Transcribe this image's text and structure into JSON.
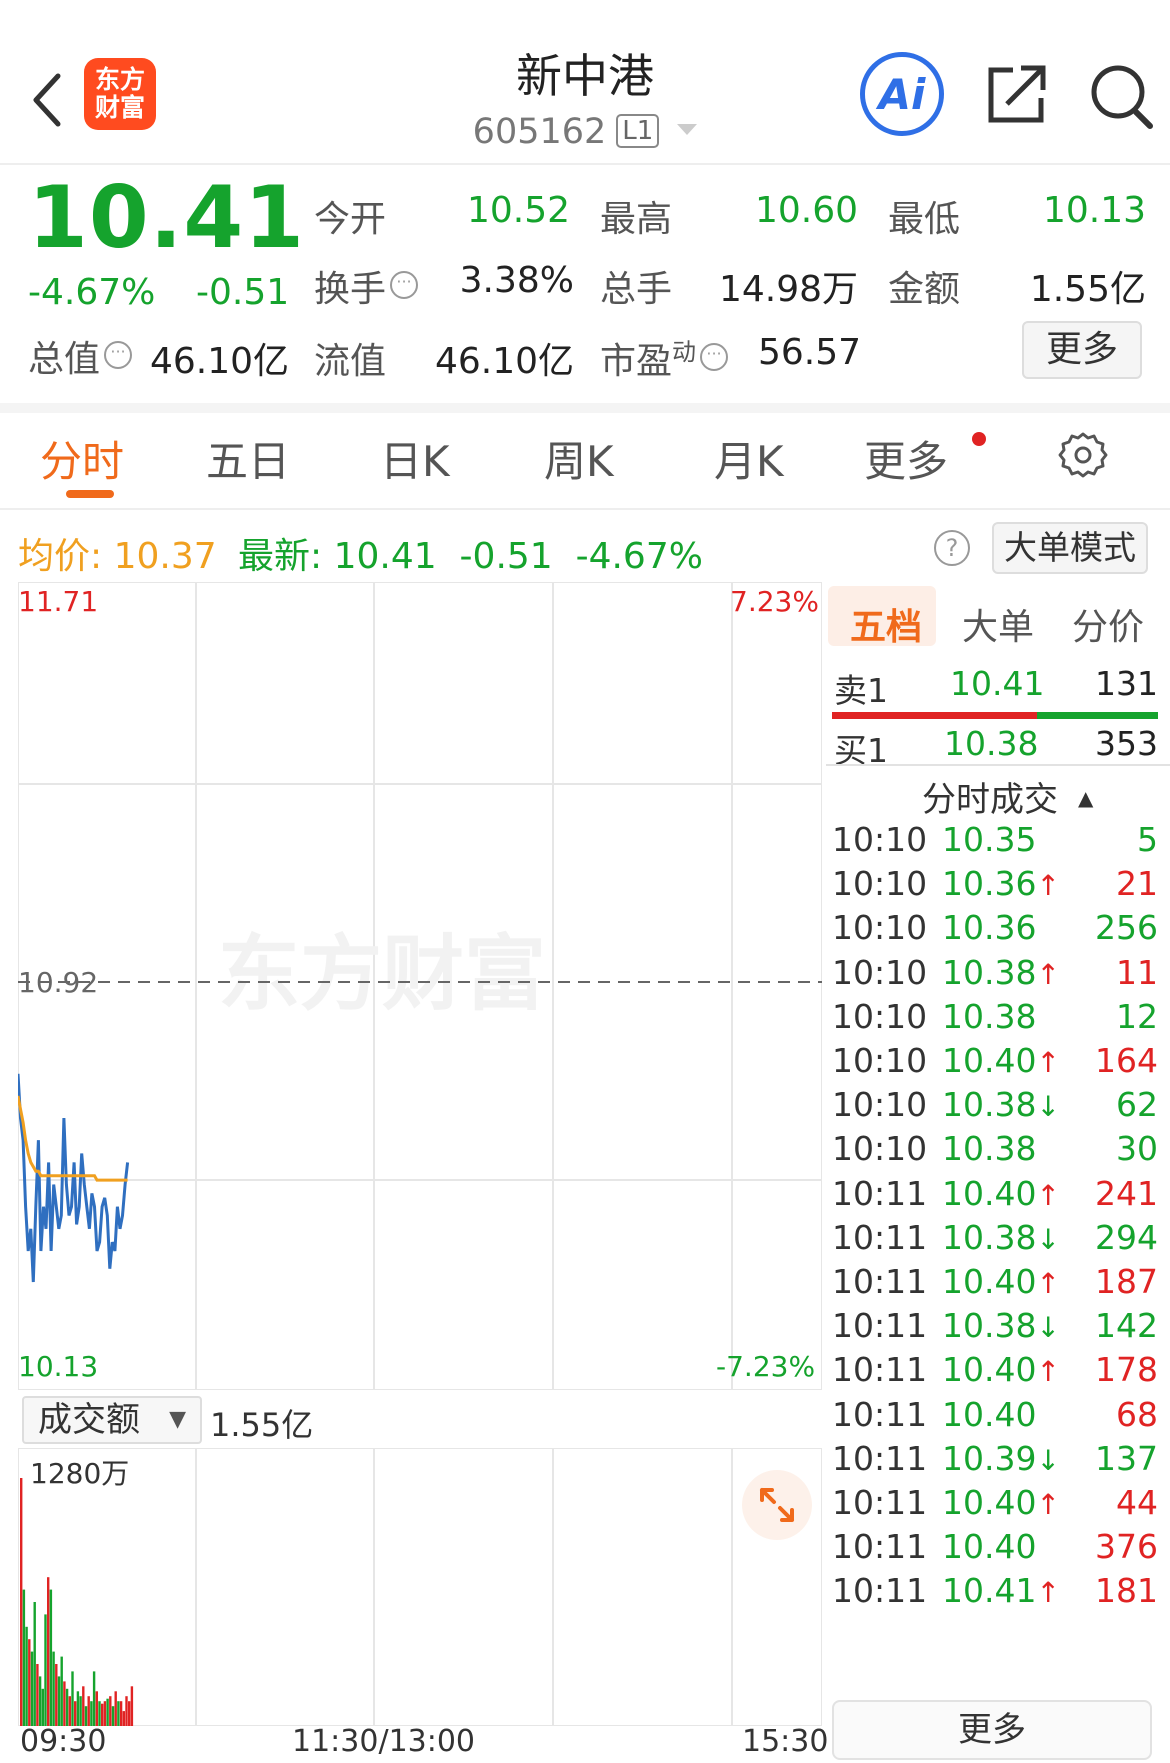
{
  "header": {
    "logo_text_line1": "东方",
    "logo_text_line2": "财富",
    "stock_name": "新中港",
    "stock_code": "605162",
    "level_badge": "L1",
    "ai_label": "Ai"
  },
  "quote": {
    "last_price": "10.41",
    "change_pct": "-4.67%",
    "change_abs": "-0.51",
    "open_label": "今开",
    "open": "10.52",
    "high_label": "最高",
    "high": "10.60",
    "low_label": "最低",
    "low": "10.13",
    "turnover_label": "换手",
    "turnover": "3.38%",
    "volume_label": "总手",
    "volume": "14.98万",
    "amount_label": "金额",
    "amount": "1.55亿",
    "mktcap_label": "总值",
    "mktcap": "46.10亿",
    "float_label": "流值",
    "float_cap": "46.10亿",
    "pe_label": "市盈",
    "pe_sup": "动",
    "pe": "56.57",
    "more_button": "更多"
  },
  "tabs": [
    "分时",
    "五日",
    "日K",
    "周K",
    "月K",
    "更多"
  ],
  "info_bar": {
    "avg_label": "均价:",
    "avg": "10.37",
    "latest_label": "最新:",
    "latest": "10.41",
    "latest_chg": "-0.51",
    "latest_pct": "-4.67%",
    "help_icon": "?",
    "big_order_mode": "大单模式"
  },
  "chart_data": {
    "type": "line",
    "y_max_label": "11.71",
    "y_min_label": "10.13",
    "pct_max_label": "7.23%",
    "pct_min_label": "-7.23%",
    "ref_label": "10.92",
    "ylim": [
      10.13,
      11.71
    ],
    "reference_close": 10.92,
    "series": [
      {
        "values": [
          10.6,
          10.5,
          10.45,
          10.3,
          10.2,
          10.25,
          10.13,
          10.3,
          10.45,
          10.2,
          10.3,
          10.25,
          10.4,
          10.2,
          10.35,
          10.3,
          10.25,
          10.28,
          10.5,
          10.35,
          10.28,
          10.3,
          10.4,
          10.26,
          10.3,
          10.42,
          10.35,
          10.3,
          10.25,
          10.33,
          10.3,
          10.2,
          10.22,
          10.3,
          10.32,
          10.28,
          10.16,
          10.22,
          10.2,
          10.3,
          10.25,
          10.28,
          10.35,
          10.4
        ]
      },
      {
        "values": [
          10.55,
          10.52,
          10.49,
          10.45,
          10.42,
          10.4,
          10.39,
          10.38,
          10.38,
          10.37,
          10.37,
          10.37,
          10.37,
          10.37,
          10.37,
          10.37,
          10.37,
          10.37,
          10.37,
          10.37,
          10.37,
          10.37,
          10.37,
          10.37,
          10.37,
          10.37,
          10.37,
          10.37,
          10.37,
          10.37,
          10.37,
          10.36,
          10.36,
          10.36,
          10.36,
          10.36,
          10.36,
          10.36,
          10.36,
          10.36,
          10.36,
          10.36,
          10.36,
          10.36
        ]
      }
    ],
    "colors": {
      "price": "#2f6fc0",
      "avg": "#f0a020",
      "up": "#e02323",
      "down": "#15a32d"
    }
  },
  "volume": {
    "selector": "成交额",
    "total": "1.55亿",
    "max_label": "1280万",
    "bars": [
      {
        "v": 1.0,
        "c": "r"
      },
      {
        "v": 0.55,
        "c": "g"
      },
      {
        "v": 0.4,
        "c": "g"
      },
      {
        "v": 0.35,
        "c": "r"
      },
      {
        "v": 0.3,
        "c": "g"
      },
      {
        "v": 0.5,
        "c": "g"
      },
      {
        "v": 0.25,
        "c": "r"
      },
      {
        "v": 0.2,
        "c": "g"
      },
      {
        "v": 0.15,
        "c": "g"
      },
      {
        "v": 0.45,
        "c": "g"
      },
      {
        "v": 0.6,
        "c": "r"
      },
      {
        "v": 0.55,
        "c": "g"
      },
      {
        "v": 0.3,
        "c": "g"
      },
      {
        "v": 0.25,
        "c": "r"
      },
      {
        "v": 0.2,
        "c": "g"
      },
      {
        "v": 0.28,
        "c": "g"
      },
      {
        "v": 0.18,
        "c": "r"
      },
      {
        "v": 0.15,
        "c": "g"
      },
      {
        "v": 0.12,
        "c": "r"
      },
      {
        "v": 0.22,
        "c": "g"
      },
      {
        "v": 0.1,
        "c": "r"
      },
      {
        "v": 0.14,
        "c": "g"
      },
      {
        "v": 0.12,
        "c": "g"
      },
      {
        "v": 0.16,
        "c": "r"
      },
      {
        "v": 0.08,
        "c": "g"
      },
      {
        "v": 0.12,
        "c": "r"
      },
      {
        "v": 0.1,
        "c": "g"
      },
      {
        "v": 0.22,
        "c": "g"
      },
      {
        "v": 0.14,
        "c": "r"
      },
      {
        "v": 0.1,
        "c": "g"
      },
      {
        "v": 0.09,
        "c": "r"
      },
      {
        "v": 0.1,
        "c": "r"
      },
      {
        "v": 0.11,
        "c": "g"
      },
      {
        "v": 0.12,
        "c": "r"
      },
      {
        "v": 0.08,
        "c": "g"
      },
      {
        "v": 0.14,
        "c": "r"
      },
      {
        "v": 0.1,
        "c": "g"
      },
      {
        "v": 0.1,
        "c": "r"
      },
      {
        "v": 0.06,
        "c": "r"
      },
      {
        "v": 0.12,
        "c": "r"
      },
      {
        "v": 0.1,
        "c": "r"
      },
      {
        "v": 0.16,
        "c": "r"
      }
    ],
    "time_labels": [
      "09:30",
      "11:30/13:00",
      "15:30"
    ]
  },
  "order_book": {
    "tabs": [
      "五档",
      "大单",
      "分价"
    ],
    "sell1_label": "卖1",
    "sell1_price": "10.41",
    "sell1_vol": "131",
    "buy1_label": "买1",
    "buy1_price": "10.38",
    "buy1_vol": "353",
    "ratio_red": 0.63
  },
  "ticks": {
    "title": "分时成交",
    "rows": [
      {
        "t": "10:10",
        "p": "10.35",
        "a": "",
        "v": "5",
        "vc": "g"
      },
      {
        "t": "10:10",
        "p": "10.36",
        "a": "↑",
        "v": "21",
        "vc": "r"
      },
      {
        "t": "10:10",
        "p": "10.36",
        "a": "",
        "v": "256",
        "vc": "g"
      },
      {
        "t": "10:10",
        "p": "10.38",
        "a": "↑",
        "v": "11",
        "vc": "r"
      },
      {
        "t": "10:10",
        "p": "10.38",
        "a": "",
        "v": "12",
        "vc": "g"
      },
      {
        "t": "10:10",
        "p": "10.40",
        "a": "↑",
        "v": "164",
        "vc": "r"
      },
      {
        "t": "10:10",
        "p": "10.38",
        "a": "↓",
        "v": "62",
        "vc": "g"
      },
      {
        "t": "10:10",
        "p": "10.38",
        "a": "",
        "v": "30",
        "vc": "g"
      },
      {
        "t": "10:11",
        "p": "10.40",
        "a": "↑",
        "v": "241",
        "vc": "r"
      },
      {
        "t": "10:11",
        "p": "10.38",
        "a": "↓",
        "v": "294",
        "vc": "g"
      },
      {
        "t": "10:11",
        "p": "10.40",
        "a": "↑",
        "v": "187",
        "vc": "r"
      },
      {
        "t": "10:11",
        "p": "10.38",
        "a": "↓",
        "v": "142",
        "vc": "g"
      },
      {
        "t": "10:11",
        "p": "10.40",
        "a": "↑",
        "v": "178",
        "vc": "r"
      },
      {
        "t": "10:11",
        "p": "10.40",
        "a": "",
        "v": "68",
        "vc": "r"
      },
      {
        "t": "10:11",
        "p": "10.39",
        "a": "↓",
        "v": "137",
        "vc": "g"
      },
      {
        "t": "10:11",
        "p": "10.40",
        "a": "↑",
        "v": "44",
        "vc": "r"
      },
      {
        "t": "10:11",
        "p": "10.40",
        "a": "",
        "v": "376",
        "vc": "r"
      },
      {
        "t": "10:11",
        "p": "10.41",
        "a": "↑",
        "v": "181",
        "vc": "r"
      }
    ],
    "more_button": "更多"
  }
}
